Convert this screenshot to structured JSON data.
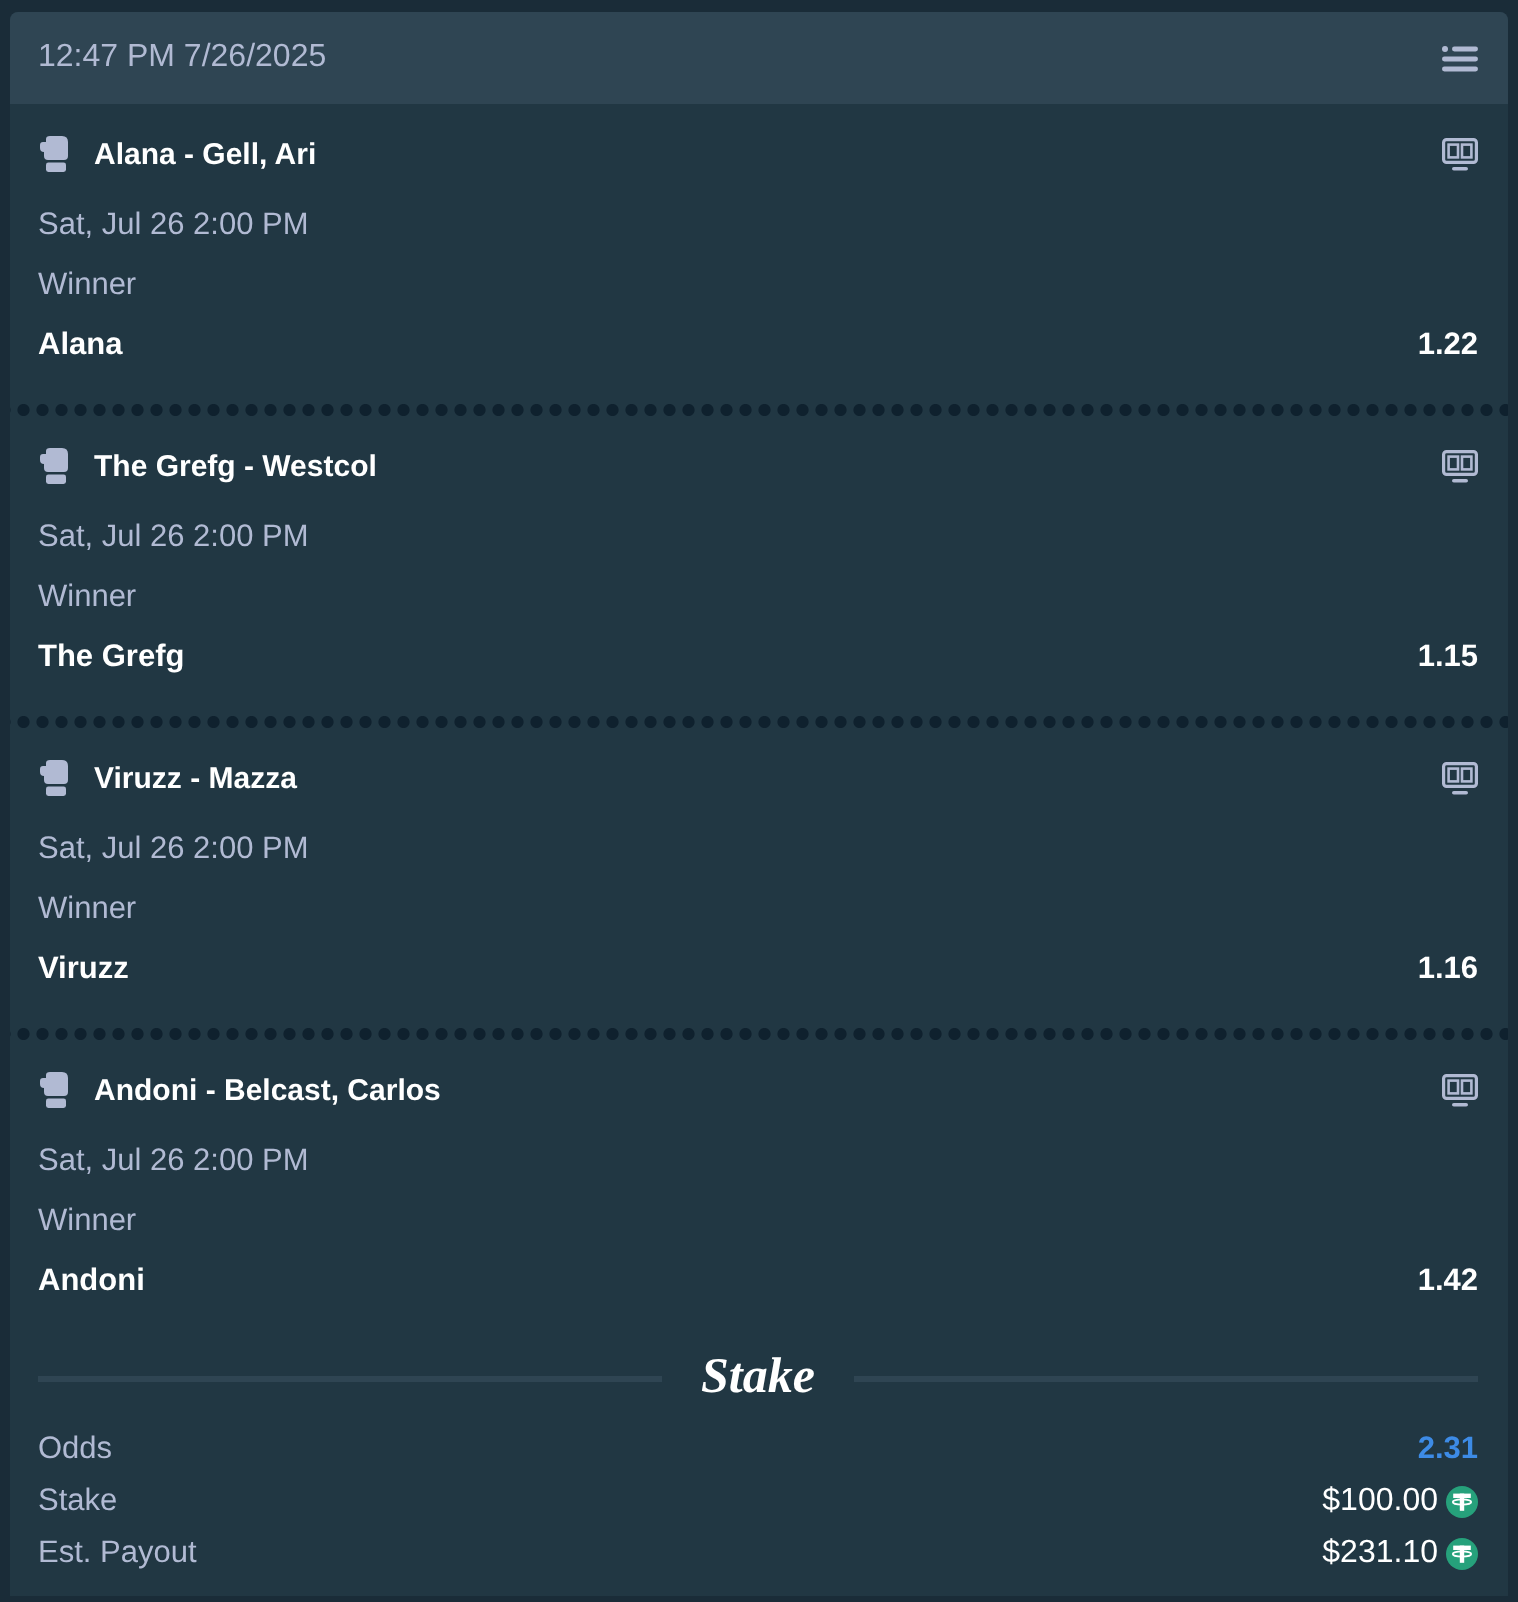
{
  "header": {
    "timestamp": "12:47 PM 7/26/2025"
  },
  "legs": [
    {
      "event": "Alana - Gell, Ari",
      "start_time": "Sat, Jul 26 2:00 PM",
      "market": "Winner",
      "selection": "Alana",
      "odds": "1.22"
    },
    {
      "event": "The Grefg - Westcol",
      "start_time": "Sat, Jul 26 2:00 PM",
      "market": "Winner",
      "selection": "The Grefg",
      "odds": "1.15"
    },
    {
      "event": "Viruzz - Mazza",
      "start_time": "Sat, Jul 26 2:00 PM",
      "market": "Winner",
      "selection": "Viruzz",
      "odds": "1.16"
    },
    {
      "event": "Andoni - Belcast, Carlos",
      "start_time": "Sat, Jul 26 2:00 PM",
      "market": "Winner",
      "selection": "Andoni",
      "odds": "1.42"
    }
  ],
  "brand": {
    "name": "Stake"
  },
  "summary": [
    {
      "label": "Odds",
      "value": "2.31",
      "kind": "odds"
    },
    {
      "label": "Stake",
      "value": "$100.00",
      "kind": "amount"
    },
    {
      "label": "Est. Payout",
      "value": "$231.10",
      "kind": "amount"
    }
  ]
}
